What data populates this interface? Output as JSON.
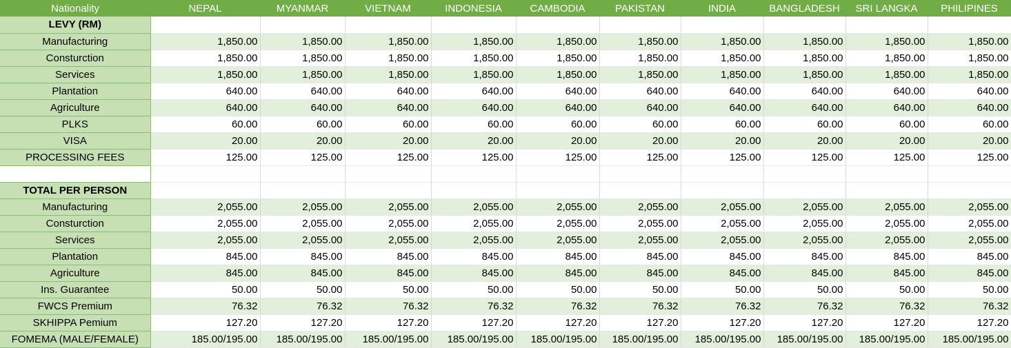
{
  "header": {
    "first": "Nationality",
    "columns": [
      "NEPAL",
      "MYANMAR",
      "VIETNAM",
      "INDONESIA",
      "CAMBODIA",
      "PAKISTAN",
      "INDIA",
      "BANGLADESH",
      "SRI LANGKA",
      "PHILIPINES"
    ]
  },
  "rows": [
    {
      "label": "LEVY (RM)",
      "kind": "section",
      "values": []
    },
    {
      "label": "Manufacturing",
      "kind": "band",
      "values": [
        "1,850.00",
        "1,850.00",
        "1,850.00",
        "1,850.00",
        "1,850.00",
        "1,850.00",
        "1,850.00",
        "1,850.00",
        "1,850.00",
        "1,850.00"
      ]
    },
    {
      "label": "Consturction",
      "kind": "plain",
      "values": [
        "1,850.00",
        "1,850.00",
        "1,850.00",
        "1,850.00",
        "1,850.00",
        "1,850.00",
        "1,850.00",
        "1,850.00",
        "1,850.00",
        "1,850.00"
      ]
    },
    {
      "label": "Services",
      "kind": "band",
      "values": [
        "1,850.00",
        "1,850.00",
        "1,850.00",
        "1,850.00",
        "1,850.00",
        "1,850.00",
        "1,850.00",
        "1,850.00",
        "1,850.00",
        "1,850.00"
      ]
    },
    {
      "label": "Plantation",
      "kind": "plain",
      "values": [
        "640.00",
        "640.00",
        "640.00",
        "640.00",
        "640.00",
        "640.00",
        "640.00",
        "640.00",
        "640.00",
        "640.00"
      ]
    },
    {
      "label": "Agriculture",
      "kind": "band",
      "values": [
        "640.00",
        "640.00",
        "640.00",
        "640.00",
        "640.00",
        "640.00",
        "640.00",
        "640.00",
        "640.00",
        "640.00"
      ]
    },
    {
      "label": "PLKS",
      "kind": "plain",
      "values": [
        "60.00",
        "60.00",
        "60.00",
        "60.00",
        "60.00",
        "60.00",
        "60.00",
        "60.00",
        "60.00",
        "60.00"
      ]
    },
    {
      "label": "VISA",
      "kind": "band",
      "values": [
        "20.00",
        "20.00",
        "20.00",
        "20.00",
        "20.00",
        "20.00",
        "20.00",
        "20.00",
        "20.00",
        "20.00"
      ]
    },
    {
      "label": "PROCESSING FEES",
      "kind": "plain",
      "values": [
        "125.00",
        "125.00",
        "125.00",
        "125.00",
        "125.00",
        "125.00",
        "125.00",
        "125.00",
        "125.00",
        "125.00"
      ]
    },
    {
      "label": "",
      "kind": "blank",
      "values": []
    },
    {
      "label": "TOTAL PER PERSON",
      "kind": "section",
      "values": []
    },
    {
      "label": "Manufacturing",
      "kind": "band",
      "values": [
        "2,055.00",
        "2,055.00",
        "2,055.00",
        "2,055.00",
        "2,055.00",
        "2,055.00",
        "2,055.00",
        "2,055.00",
        "2,055.00",
        "2,055.00"
      ]
    },
    {
      "label": "Consturction",
      "kind": "plain",
      "values": [
        "2,055.00",
        "2,055.00",
        "2,055.00",
        "2,055.00",
        "2,055.00",
        "2,055.00",
        "2,055.00",
        "2,055.00",
        "2,055.00",
        "2,055.00"
      ]
    },
    {
      "label": "Services",
      "kind": "band",
      "values": [
        "2,055.00",
        "2,055.00",
        "2,055.00",
        "2,055.00",
        "2,055.00",
        "2,055.00",
        "2,055.00",
        "2,055.00",
        "2,055.00",
        "2,055.00"
      ]
    },
    {
      "label": "Plantation",
      "kind": "plain",
      "values": [
        "845.00",
        "845.00",
        "845.00",
        "845.00",
        "845.00",
        "845.00",
        "845.00",
        "845.00",
        "845.00",
        "845.00"
      ]
    },
    {
      "label": "Agriculture",
      "kind": "band",
      "values": [
        "845.00",
        "845.00",
        "845.00",
        "845.00",
        "845.00",
        "845.00",
        "845.00",
        "845.00",
        "845.00",
        "845.00"
      ]
    },
    {
      "label": "Ins. Guarantee",
      "kind": "plain",
      "values": [
        "50.00",
        "50.00",
        "50.00",
        "50.00",
        "50.00",
        "50.00",
        "50.00",
        "50.00",
        "50.00",
        "50.00"
      ]
    },
    {
      "label": "FWCS Premium",
      "kind": "band",
      "values": [
        "76.32",
        "76.32",
        "76.32",
        "76.32",
        "76.32",
        "76.32",
        "76.32",
        "76.32",
        "76.32",
        "76.32"
      ]
    },
    {
      "label": "SKHIPPA Pemium",
      "kind": "plain",
      "values": [
        "127.20",
        "127.20",
        "127.20",
        "127.20",
        "127.20",
        "127.20",
        "127.20",
        "127.20",
        "127.20",
        "127.20"
      ]
    },
    {
      "label": "FOMEMA (MALE/FEMALE)",
      "kind": "band",
      "values": [
        "185.00/195.00",
        "185.00/195.00",
        "185.00/195.00",
        "185.00/195.00",
        "185.00/195.00",
        "185.00/195.00",
        "185.00/195.00",
        "185.00/195.00",
        "185.00/195.00",
        "185.00/195.00"
      ]
    }
  ]
}
